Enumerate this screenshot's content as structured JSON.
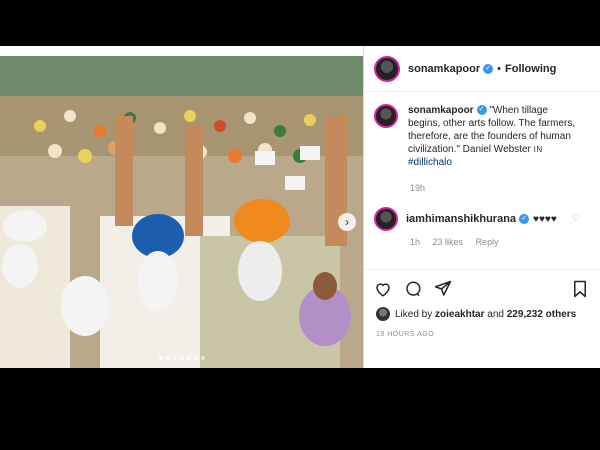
{
  "post": {
    "username": "sonamkapoor",
    "separator": "•",
    "follow_status": "Following",
    "caption": {
      "username": "sonamkapoor",
      "text": "\"When tillage begins, other arts follow. The farmers, therefore, are the founders of human civilization.\" Daniel Webster",
      "in_label": "IN",
      "hashtag": "#dillichalo",
      "time": "19h"
    },
    "reply": {
      "username": "iamhimanshikhurana",
      "text": "♥♥♥♥",
      "time": "1h",
      "likes": "23 likes",
      "reply_label": "Reply"
    },
    "liked_by": {
      "prefix": "Liked by",
      "user": "zoieakhtar",
      "and": "and",
      "count": "229,232 others"
    },
    "time_ago": "19 HOURS AGO",
    "carousel": {
      "slides": 7,
      "active": 0
    }
  },
  "icons": [
    "heart-icon",
    "comment-icon",
    "share-icon",
    "bookmark-icon",
    "verified-icon",
    "next-arrow-icon"
  ],
  "colors": {
    "verified": "#3897f0",
    "hashtag": "#00376b",
    "story_ring": "#d6249f"
  }
}
